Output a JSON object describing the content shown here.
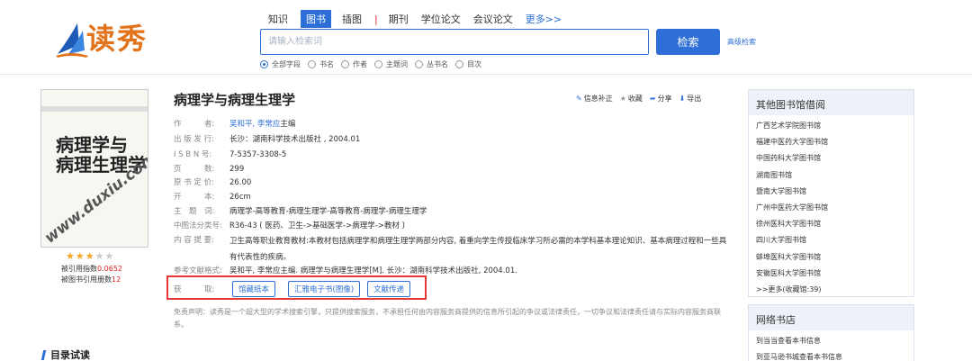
{
  "header": {
    "logo_text": "读秀",
    "nav": [
      "知识",
      "图书",
      "插图",
      "|",
      "期刊",
      "学位论文",
      "会议论文",
      "更多>>"
    ],
    "active_tab": "图书",
    "search_placeholder": "请输入检索词",
    "search_button": "检索",
    "advanced_search": "高级检索",
    "search_fields": [
      {
        "label": "全部字段",
        "selected": true
      },
      {
        "label": "书名",
        "selected": false
      },
      {
        "label": "作者",
        "selected": false
      },
      {
        "label": "主题词",
        "selected": false
      },
      {
        "label": "丛书名",
        "selected": false
      },
      {
        "label": "目次",
        "selected": false
      }
    ],
    "accent_color": "#2d6fd6"
  },
  "cover": {
    "title_text": "病理学与病理生理学",
    "watermark": "www.duxiu.com",
    "rating": 3,
    "rating_max": 5
  },
  "citations": {
    "index_label": "被引用指数",
    "index_value": "0.0652",
    "count_label": "被图书引用册数",
    "count_value": "12"
  },
  "book": {
    "title": "病理学与病理生理学",
    "actions": [
      "信息补正",
      "收藏",
      "分享",
      "导出"
    ],
    "author_label": "作　　　者:",
    "authors": "吴和平, 李常应",
    "author_suffix": "主编",
    "publisher_label": "出 版 发 行:",
    "publisher": "长沙：湖南科学技术出版社 , 2004.01",
    "isbn_label": "I S B N 号:",
    "isbn": "7-5357-3308-5",
    "pages_label": "页　　　数:",
    "pages": "299",
    "price_label": "原 书 定 价:",
    "price": "26.00",
    "size_label": "开　　　本:",
    "size": "26cm",
    "subject_label": "主　题　词:",
    "subject": "病理学-高等教育-病理生理学-高等教育-病理学-病理生理学",
    "clc_label": "中图法分类号:",
    "clc": "R36-43 ( 医药、卫生->基础医学->病理学->教材 )",
    "summary_label": "内 容 提 要:",
    "summary": "卫生高等职业教育教材:本教材包括病理学和病理生理学两部分内容, 着重向学生传授临床学习所必需的本学科基本理论知识、基本病理过程和一些具有代表性的疾病。",
    "ref_label": "参考文献格式:",
    "ref": "吴和平, 李常应主编. 病理学与病理生理学[M]. 长沙：湖南科学技术出版社, 2004.01.",
    "get_label": "获　　　取:",
    "get_buttons": [
      "馆藏纸本",
      "汇雅电子书(图像)",
      "文献传递"
    ],
    "disclaimer": "免责声明：读秀是一个超大型的学术搜索引擎，只提供搜索服务，不承担任何由内容服务商提供的信息所引起的争议或法律责任，一切争议和法律责任请与实际内容服务商联系。"
  },
  "toc_title": "目录试读",
  "libraries": {
    "title": "其他图书馆借阅",
    "items": [
      "广西艺术学院图书馆",
      "福建中医药大学图书馆",
      "中国药科大学图书馆",
      "湖南图书馆",
      "暨南大学图书馆",
      "广州中医药大学图书馆",
      "徐州医科大学图书馆",
      "四川大学图书馆",
      "蚌埠医科大学图书馆",
      "安徽医科大学图书馆",
      ">>更多(收藏馆:39)"
    ]
  },
  "bookstores": {
    "title": "网络书店",
    "items": [
      "到当当查看本书信息",
      "到亚马逊书城查看本书信息"
    ]
  }
}
